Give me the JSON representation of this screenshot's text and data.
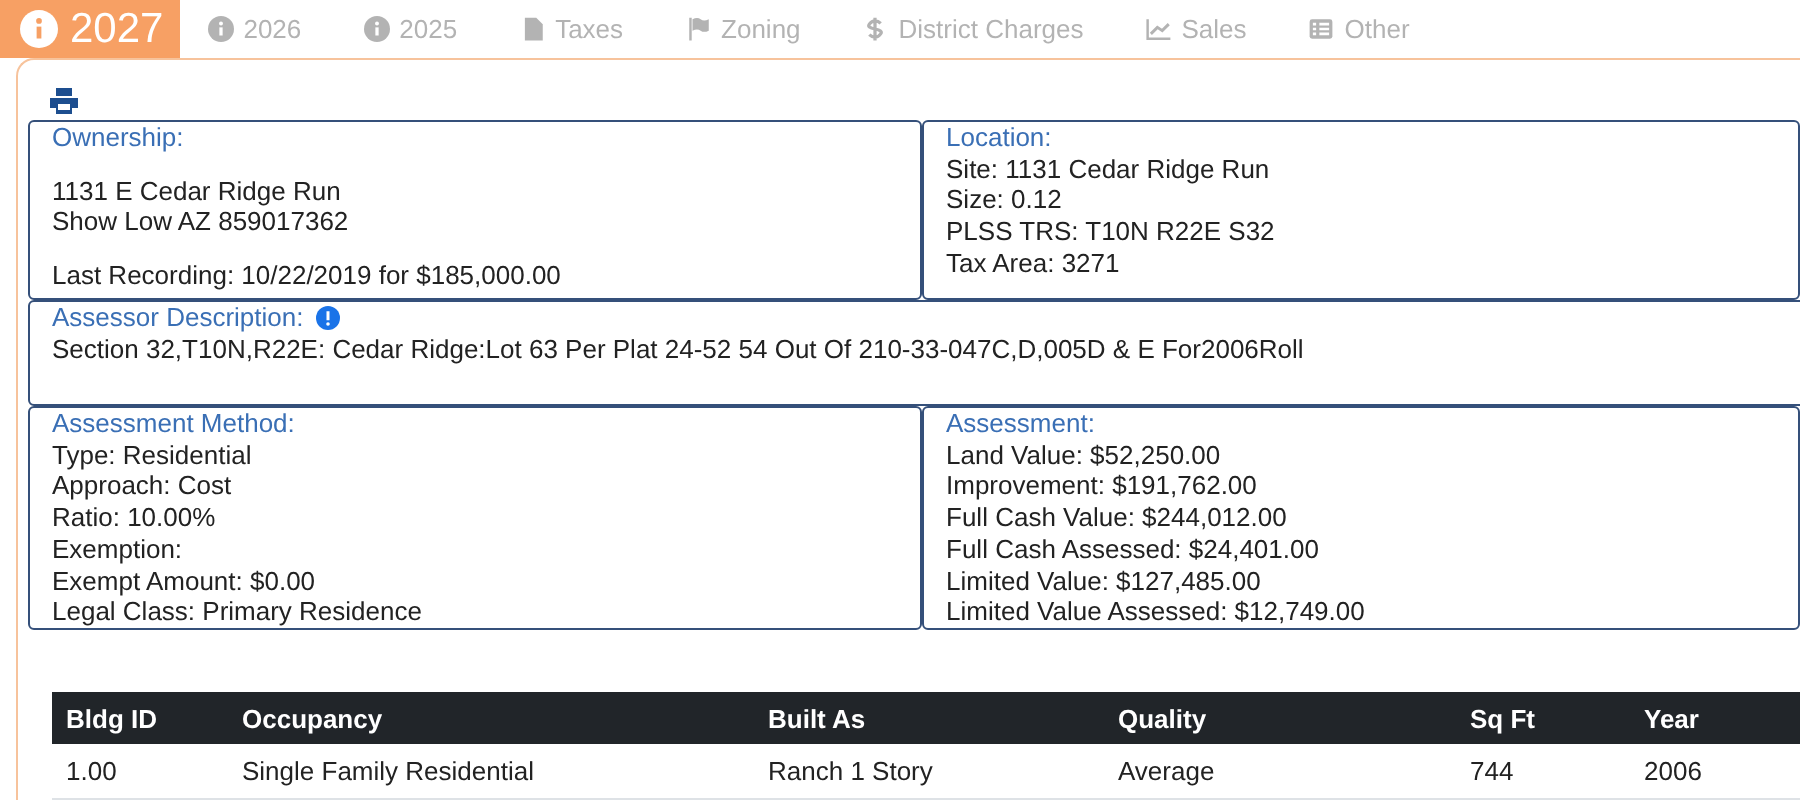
{
  "tabs": [
    {
      "label": "2027",
      "selected": true
    },
    {
      "label": "2026",
      "selected": false
    },
    {
      "label": "2025",
      "selected": false
    },
    {
      "label": "Taxes",
      "selected": false
    },
    {
      "label": "Zoning",
      "selected": false
    },
    {
      "label": "District Charges",
      "selected": false
    },
    {
      "label": "Sales",
      "selected": false
    },
    {
      "label": "Other",
      "selected": false
    }
  ],
  "ownership": {
    "label": "Ownership:",
    "address": [
      "1131 E Cedar Ridge Run",
      "Show Low AZ 859017362"
    ],
    "recording": "Last Recording: 10/22/2019 for $185,000.00"
  },
  "location": {
    "label": "Location:",
    "lines": [
      "Site: 1131 Cedar Ridge Run",
      "Size: 0.12",
      "PLSS TRS: T10N R22E S32",
      "Tax Area: 3271"
    ]
  },
  "assessor_description": {
    "label": "Assessor Description:",
    "text": "Section 32,T10N,R22E: Cedar Ridge:Lot 63 Per Plat 24-52 54 Out Of 210-33-047C,D,005D & E For2006Roll"
  },
  "assessment_method": {
    "label": "Assessment Method:",
    "lines": [
      "Type: Residential",
      "Approach: Cost",
      "Ratio: 10.00%",
      "Exemption:",
      "Exempt Amount: $0.00",
      "Legal Class: Primary Residence"
    ]
  },
  "assessment": {
    "label": "Assessment:",
    "lines": [
      "Land Value: $52,250.00",
      "Improvement: $191,762.00",
      "Full Cash Value: $244,012.00",
      "Full Cash Assessed: $24,401.00",
      "Limited Value: $127,485.00",
      "Limited Value Assessed: $12,749.00"
    ]
  },
  "table": {
    "columns": [
      "Bldg ID",
      "Occupancy",
      "Built As",
      "Quality",
      "Sq Ft",
      "Year"
    ],
    "rows": [
      [
        "1.00",
        "Single Family Residential",
        "Ranch 1 Story",
        "Average",
        "744",
        "2006"
      ]
    ]
  }
}
